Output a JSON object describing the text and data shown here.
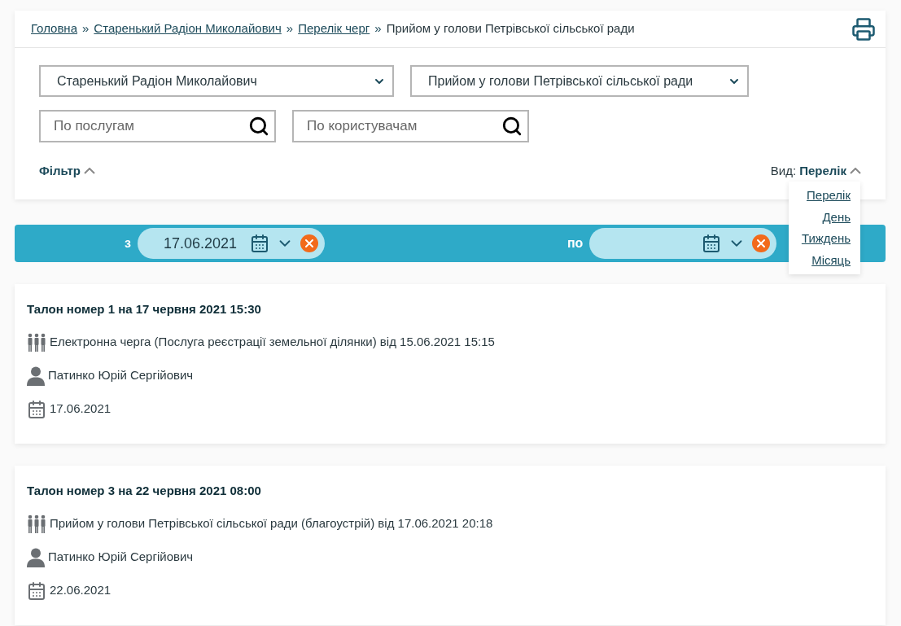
{
  "breadcrumb": [
    {
      "kind": "link",
      "text": "Головна"
    },
    {
      "kind": "separator",
      "text": "»"
    },
    {
      "kind": "link",
      "text": "Старенький Радіон Миколайович"
    },
    {
      "kind": "separator",
      "text": "»"
    },
    {
      "kind": "link",
      "text": "Перелік черг"
    },
    {
      "kind": "separator",
      "text": "»"
    },
    {
      "kind": "current",
      "text": "Прийом у голови Петрівської сільської ради"
    }
  ],
  "selects": [
    {
      "value": "Старенький Радіон Миколайович"
    },
    {
      "value": "Прийом у голови Петрівської сільської ради"
    }
  ],
  "searches": [
    {
      "placeholder": "По послугам"
    },
    {
      "placeholder": "По користувачам"
    }
  ],
  "filter_toggle": {
    "label": "Фільтр",
    "expanded": true
  },
  "view": {
    "label": "Вид:",
    "value": "Перелік",
    "expanded": true,
    "options": [
      {
        "label": "Перелік"
      },
      {
        "label": "День"
      },
      {
        "label": "Тиждень"
      },
      {
        "label": "Місяць"
      }
    ]
  },
  "date_range": {
    "from": {
      "label": "з",
      "value": "17.06.2021"
    },
    "to": {
      "label": "по"
    }
  },
  "tickets": [
    {
      "title": "Талон номер 1 на 17 червня 2021 15:30",
      "service": "Електронна черга (Послуга реєстрації земельної ділянки) від 15.06.2021 15:15",
      "person": "Патинко Юрій Сергійович",
      "date": "17.06.2021"
    },
    {
      "title": "Талон номер 3 на 22 червня 2021 08:00",
      "service": "Прийом у голови Петрівської сільської ради (благоустрій) від 17.06.2021 20:18",
      "person": "Патинко Юрій Сергійович",
      "date": "22.06.2021"
    }
  ]
}
